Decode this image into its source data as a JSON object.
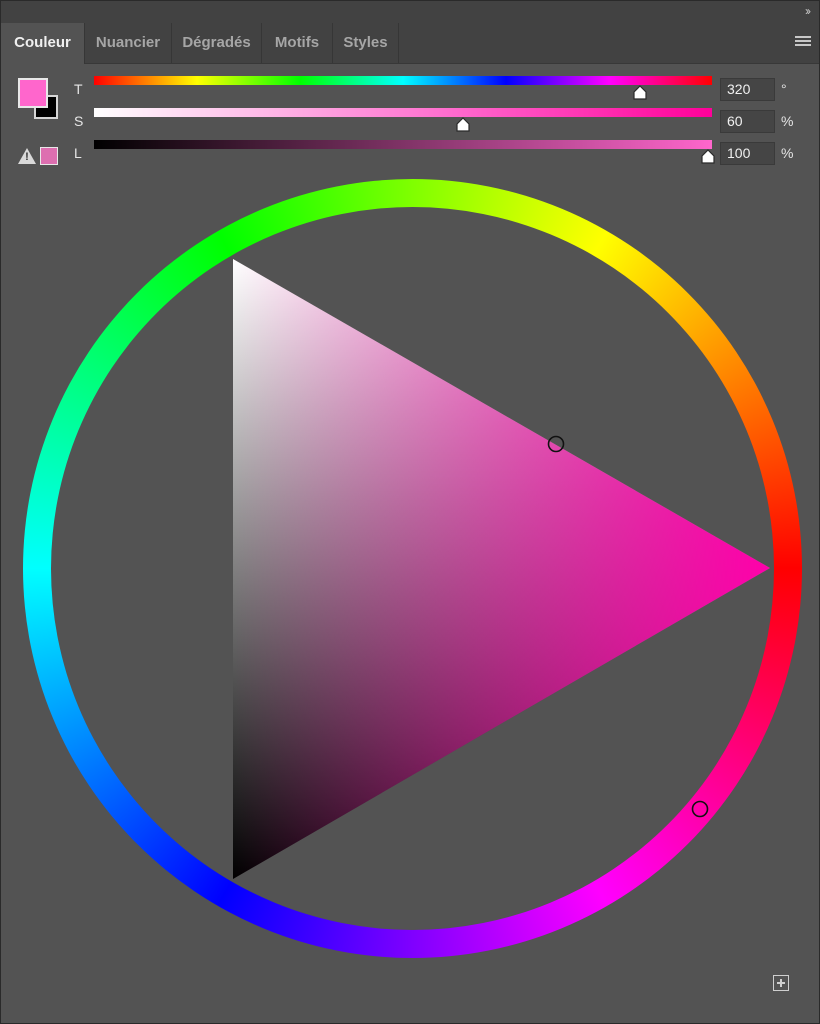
{
  "tabs": [
    {
      "label": "Couleur",
      "active": true
    },
    {
      "label": "Nuancier",
      "active": false
    },
    {
      "label": "Dégradés",
      "active": false
    },
    {
      "label": "Motifs",
      "active": false
    },
    {
      "label": "Styles",
      "active": false
    }
  ],
  "icons": {
    "collapse": "double-chevron-right-icon",
    "menu": "hamburger-menu-icon",
    "warning": "gamut-warning-icon",
    "add": "add-swatch-icon"
  },
  "colors": {
    "foreground": "#ff66cc",
    "background": "#000000",
    "gamut_swatch": "#dd6fb0"
  },
  "sliders": {
    "hue": {
      "label": "T",
      "value": "320",
      "unit": "°",
      "max": 360
    },
    "saturation": {
      "label": "S",
      "value": "60",
      "unit": "%",
      "max": 100
    },
    "lightness": {
      "label": "L",
      "value": "100",
      "unit": "%",
      "max": 100
    }
  },
  "wheel": {
    "hue_marker_deg": 320
  },
  "collapse_glyph": "››"
}
